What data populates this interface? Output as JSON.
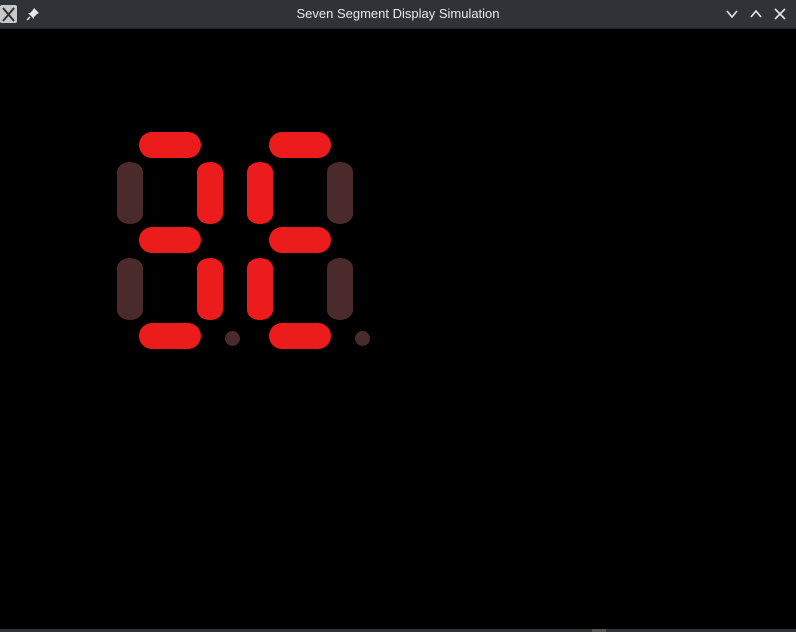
{
  "window": {
    "title": "Seven Segment Display Simulation",
    "icons": {
      "app": "x-app-icon",
      "pin": "pin-icon",
      "minimize": "chevron-down-icon",
      "maximize": "chevron-up-icon",
      "close": "close-icon"
    }
  },
  "display": {
    "on_color": "#ed1c1c",
    "off_color": "#4a2a2a",
    "digits": [
      {
        "segments": {
          "a": true,
          "b": true,
          "c": true,
          "d": true,
          "e": false,
          "f": false,
          "g": true
        },
        "decimal_point": false
      },
      {
        "segments": {
          "a": true,
          "b": false,
          "c": false,
          "d": true,
          "e": true,
          "f": true,
          "g": true
        },
        "decimal_point": false
      }
    ]
  }
}
